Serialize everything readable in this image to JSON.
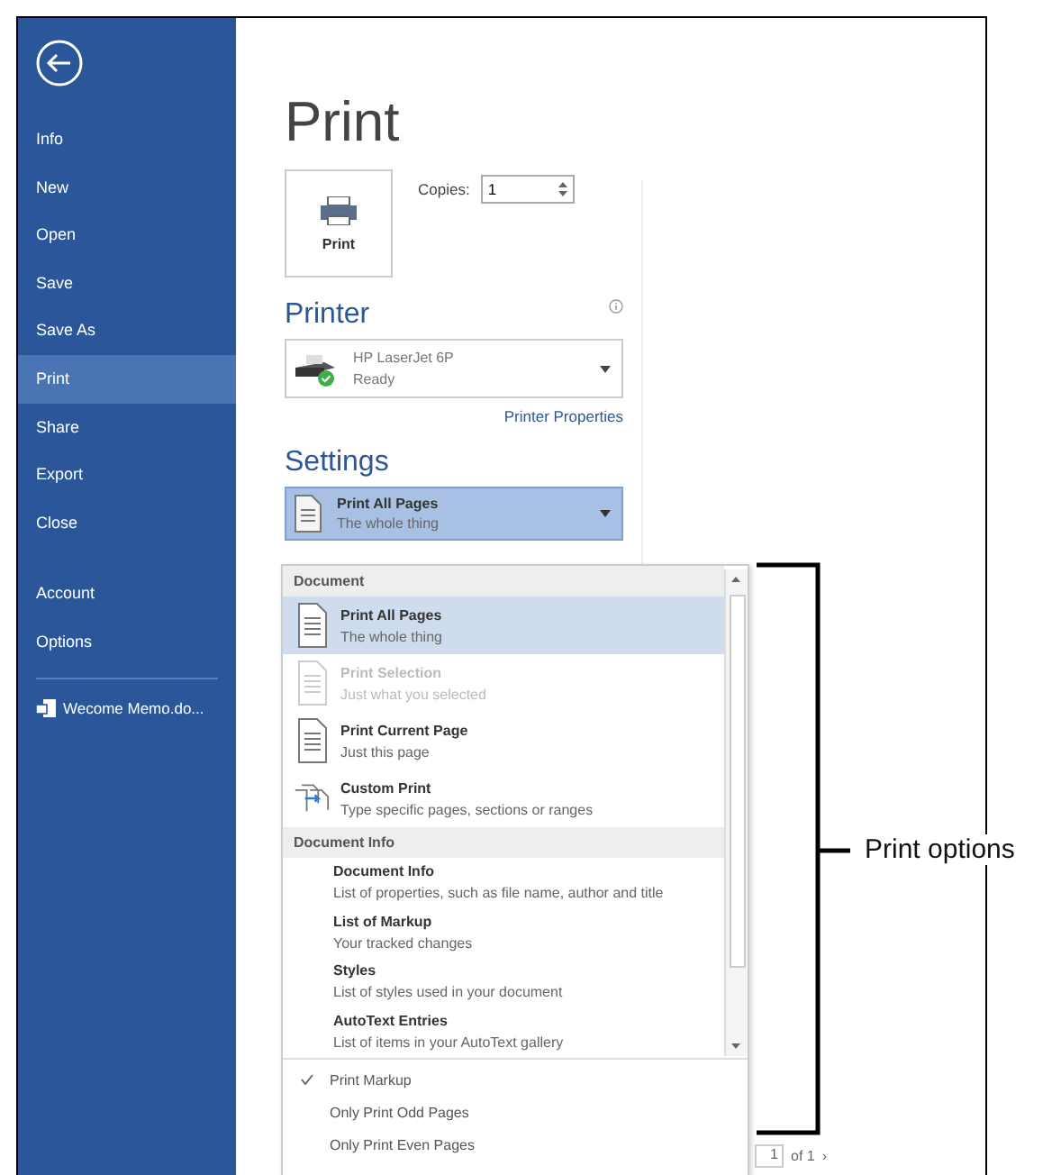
{
  "sidebar": {
    "items": [
      {
        "label": "Info",
        "selected": false
      },
      {
        "label": "New",
        "selected": false
      },
      {
        "label": "Open",
        "selected": false
      },
      {
        "label": "Save",
        "selected": false
      },
      {
        "label": "Save As",
        "selected": false
      },
      {
        "label": "Print",
        "selected": true
      },
      {
        "label": "Share",
        "selected": false
      },
      {
        "label": "Export",
        "selected": false
      },
      {
        "label": "Close",
        "selected": false
      }
    ],
    "bottom_items": [
      {
        "label": "Account",
        "selected": false
      },
      {
        "label": "Options",
        "selected": false
      }
    ],
    "recent_document": "Wecome Memo.do..."
  },
  "title": "Print",
  "print_button": "Print",
  "copies": {
    "label": "Copies:",
    "value": "1"
  },
  "printer": {
    "heading": "Printer",
    "name": "HP LaserJet 6P",
    "status": "Ready",
    "properties_link": "Printer Properties"
  },
  "settings": {
    "heading": "Settings",
    "title": "Print All Pages",
    "subtitle": "The whole thing"
  },
  "page_nav": {
    "value": "1",
    "of": "of 1",
    "next": "›"
  },
  "menu": {
    "sections": [
      {
        "heading": "Document",
        "items": [
          {
            "kind": "page",
            "title": "Print All Pages",
            "subtitle": "The whole thing",
            "selected": true,
            "disabled": false
          },
          {
            "kind": "page",
            "title": "Print Selection",
            "subtitle": "Just what you selected",
            "selected": false,
            "disabled": true
          },
          {
            "kind": "page",
            "title": "Print Current Page",
            "subtitle": "Just this page",
            "selected": false,
            "disabled": false
          },
          {
            "kind": "custom",
            "title": "Custom Print",
            "subtitle": "Type specific pages, sections or ranges",
            "selected": false,
            "disabled": false
          }
        ]
      },
      {
        "heading": "Document Info",
        "items": [
          {
            "kind": "text",
            "title": "Document Info",
            "subtitle": "List of properties, such as file name, author and title",
            "selected": false,
            "disabled": false
          },
          {
            "kind": "text",
            "title": "List of Markup",
            "subtitle": "Your tracked changes",
            "selected": false,
            "disabled": false
          },
          {
            "kind": "text",
            "title": "Styles",
            "subtitle": "List of styles used in your document",
            "selected": false,
            "disabled": false
          },
          {
            "kind": "text",
            "title": "AutoText Entries",
            "subtitle": "List of items in your AutoText gallery",
            "selected": false,
            "disabled": false
          }
        ]
      }
    ],
    "toggles": [
      {
        "label": "Print Markup",
        "checked": true
      },
      {
        "label": "Only Print Odd Pages",
        "checked": false
      },
      {
        "label": "Only Print Even Pages",
        "checked": false
      }
    ]
  },
  "callout": "Print options"
}
